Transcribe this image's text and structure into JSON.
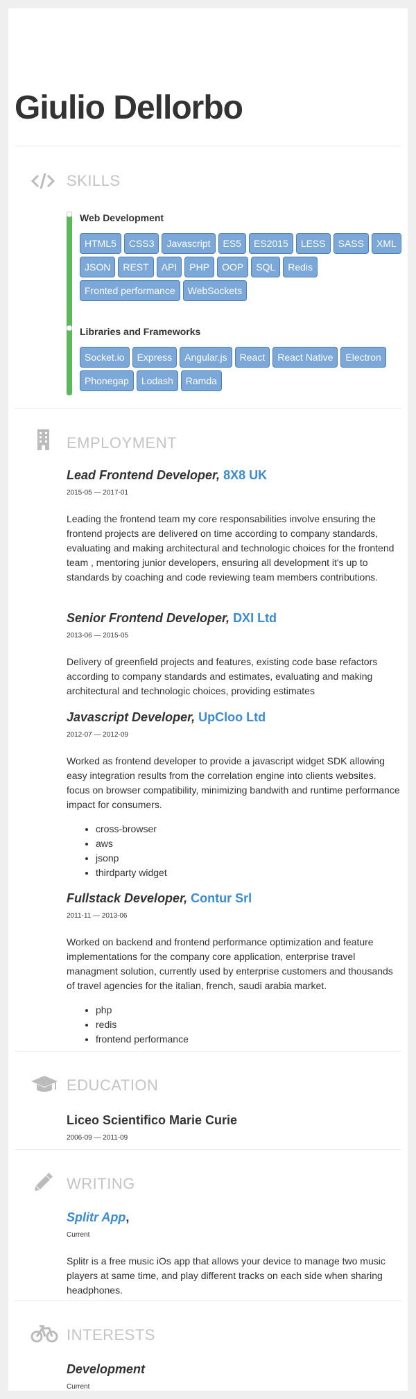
{
  "header": {
    "name": "Giulio Dellorbo"
  },
  "sections": {
    "skills": {
      "title": "SKILLS",
      "icon": "code-icon"
    },
    "employment": {
      "title": "EMPLOYMENT",
      "icon": "building-icon"
    },
    "education": {
      "title": "EDUCATION",
      "icon": "graduation-cap-icon"
    },
    "writing": {
      "title": "WRITING",
      "icon": "pencil-icon"
    },
    "interests": {
      "title": "INTERESTS",
      "icon": "bicycle-icon"
    }
  },
  "skills": [
    {
      "name": "Web Development",
      "level": "100%",
      "keywords": [
        "HTML5",
        "CSS3",
        "Javascript",
        "ES5",
        "ES2015",
        "LESS",
        "SASS",
        "XML",
        "JSON",
        "REST",
        "API",
        "PHP",
        "OOP",
        "SQL",
        "Redis",
        "Fronted performance",
        "WebSockets"
      ]
    },
    {
      "name": "Libraries and Frameworks",
      "level": "100%",
      "keywords": [
        "Socket.io",
        "Express",
        "Angular.js",
        "React",
        "React Native",
        "Electron",
        "Phonegap",
        "Lodash",
        "Ramda"
      ]
    }
  ],
  "employment": [
    {
      "position": "Lead Frontend Developer",
      "company": "8X8 UK",
      "dates": "2015-05 — 2017-01",
      "summary": "Leading the frontend team my core responsabilities involve ensuring the frontend projects are delivered on time according to company standards, evaluating and making architectural and technologic choices for the frontend team , mentoring junior developers, ensuring all development it's up to standards by coaching and code reviewing team members contributions.",
      "highlights": []
    },
    {
      "position": "Senior Frontend Developer",
      "company": "DXI Ltd",
      "dates": "2013-06 — 2015-05",
      "summary": "Delivery of greenfield projects and features, existing code base refactors according to company standards and estimates, evaluating and making architectural and technologic choices, providing estimates",
      "highlights": []
    },
    {
      "position": "Javascript Developer",
      "company": "UpCloo Ltd",
      "dates": "2012-07 — 2012-09",
      "summary": "Worked as frontend developer to provide a javascript widget SDK allowing easy integration results from the correlation engine into clients websites. focus on browser compatibility, minimizing bandwith and runtime performance impact for consumers.",
      "highlights": [
        "cross-browser",
        "aws",
        "jsonp",
        "thirdparty widget"
      ]
    },
    {
      "position": "Fullstack Developer",
      "company": "Contur Srl",
      "dates": "2011-11 — 2013-06",
      "summary": "Worked on backend and frontend performance optimization and feature implementations for the company core application, enterprise travel managment solution, currently used by enterprise customers and thousands of travel agencies for the italian, french, saudi arabia market.",
      "highlights": [
        "php",
        "redis",
        "frontend performance"
      ]
    }
  ],
  "education": [
    {
      "institution": "Liceo Scientifico Marie Curie",
      "dates": "2006-09 — 2011-09"
    }
  ],
  "writing": [
    {
      "name": "Splitr App",
      "comma": ",",
      "dates": "Current",
      "summary": "Splitr is a free music iOs app that allows your device to manage two music players at same time, and play different tracks on each side when sharing headphones."
    }
  ],
  "interests": [
    {
      "name": "Development",
      "dates": "Current"
    }
  ]
}
